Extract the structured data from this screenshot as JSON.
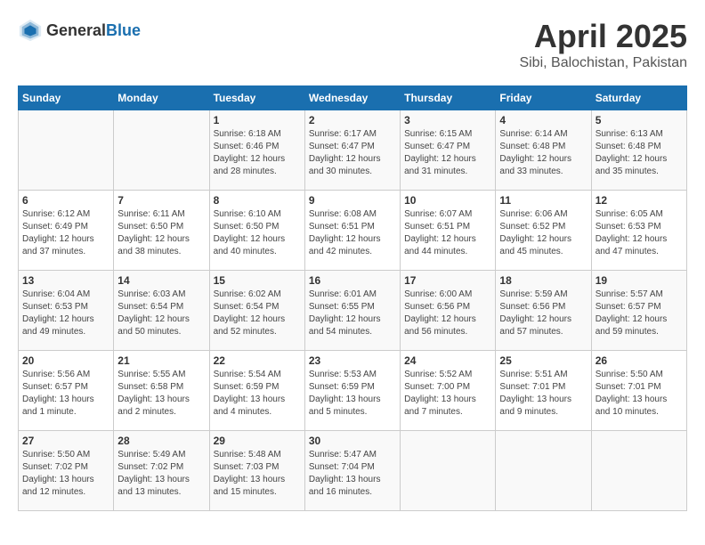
{
  "header": {
    "logo_general": "General",
    "logo_blue": "Blue",
    "month_year": "April 2025",
    "location": "Sibi, Balochistan, Pakistan"
  },
  "weekdays": [
    "Sunday",
    "Monday",
    "Tuesday",
    "Wednesday",
    "Thursday",
    "Friday",
    "Saturday"
  ],
  "weeks": [
    [
      {
        "day": "",
        "info": ""
      },
      {
        "day": "",
        "info": ""
      },
      {
        "day": "1",
        "sunrise": "Sunrise: 6:18 AM",
        "sunset": "Sunset: 6:46 PM",
        "daylight": "Daylight: 12 hours and 28 minutes."
      },
      {
        "day": "2",
        "sunrise": "Sunrise: 6:17 AM",
        "sunset": "Sunset: 6:47 PM",
        "daylight": "Daylight: 12 hours and 30 minutes."
      },
      {
        "day": "3",
        "sunrise": "Sunrise: 6:15 AM",
        "sunset": "Sunset: 6:47 PM",
        "daylight": "Daylight: 12 hours and 31 minutes."
      },
      {
        "day": "4",
        "sunrise": "Sunrise: 6:14 AM",
        "sunset": "Sunset: 6:48 PM",
        "daylight": "Daylight: 12 hours and 33 minutes."
      },
      {
        "day": "5",
        "sunrise": "Sunrise: 6:13 AM",
        "sunset": "Sunset: 6:48 PM",
        "daylight": "Daylight: 12 hours and 35 minutes."
      }
    ],
    [
      {
        "day": "6",
        "sunrise": "Sunrise: 6:12 AM",
        "sunset": "Sunset: 6:49 PM",
        "daylight": "Daylight: 12 hours and 37 minutes."
      },
      {
        "day": "7",
        "sunrise": "Sunrise: 6:11 AM",
        "sunset": "Sunset: 6:50 PM",
        "daylight": "Daylight: 12 hours and 38 minutes."
      },
      {
        "day": "8",
        "sunrise": "Sunrise: 6:10 AM",
        "sunset": "Sunset: 6:50 PM",
        "daylight": "Daylight: 12 hours and 40 minutes."
      },
      {
        "day": "9",
        "sunrise": "Sunrise: 6:08 AM",
        "sunset": "Sunset: 6:51 PM",
        "daylight": "Daylight: 12 hours and 42 minutes."
      },
      {
        "day": "10",
        "sunrise": "Sunrise: 6:07 AM",
        "sunset": "Sunset: 6:51 PM",
        "daylight": "Daylight: 12 hours and 44 minutes."
      },
      {
        "day": "11",
        "sunrise": "Sunrise: 6:06 AM",
        "sunset": "Sunset: 6:52 PM",
        "daylight": "Daylight: 12 hours and 45 minutes."
      },
      {
        "day": "12",
        "sunrise": "Sunrise: 6:05 AM",
        "sunset": "Sunset: 6:53 PM",
        "daylight": "Daylight: 12 hours and 47 minutes."
      }
    ],
    [
      {
        "day": "13",
        "sunrise": "Sunrise: 6:04 AM",
        "sunset": "Sunset: 6:53 PM",
        "daylight": "Daylight: 12 hours and 49 minutes."
      },
      {
        "day": "14",
        "sunrise": "Sunrise: 6:03 AM",
        "sunset": "Sunset: 6:54 PM",
        "daylight": "Daylight: 12 hours and 50 minutes."
      },
      {
        "day": "15",
        "sunrise": "Sunrise: 6:02 AM",
        "sunset": "Sunset: 6:54 PM",
        "daylight": "Daylight: 12 hours and 52 minutes."
      },
      {
        "day": "16",
        "sunrise": "Sunrise: 6:01 AM",
        "sunset": "Sunset: 6:55 PM",
        "daylight": "Daylight: 12 hours and 54 minutes."
      },
      {
        "day": "17",
        "sunrise": "Sunrise: 6:00 AM",
        "sunset": "Sunset: 6:56 PM",
        "daylight": "Daylight: 12 hours and 56 minutes."
      },
      {
        "day": "18",
        "sunrise": "Sunrise: 5:59 AM",
        "sunset": "Sunset: 6:56 PM",
        "daylight": "Daylight: 12 hours and 57 minutes."
      },
      {
        "day": "19",
        "sunrise": "Sunrise: 5:57 AM",
        "sunset": "Sunset: 6:57 PM",
        "daylight": "Daylight: 12 hours and 59 minutes."
      }
    ],
    [
      {
        "day": "20",
        "sunrise": "Sunrise: 5:56 AM",
        "sunset": "Sunset: 6:57 PM",
        "daylight": "Daylight: 13 hours and 1 minute."
      },
      {
        "day": "21",
        "sunrise": "Sunrise: 5:55 AM",
        "sunset": "Sunset: 6:58 PM",
        "daylight": "Daylight: 13 hours and 2 minutes."
      },
      {
        "day": "22",
        "sunrise": "Sunrise: 5:54 AM",
        "sunset": "Sunset: 6:59 PM",
        "daylight": "Daylight: 13 hours and 4 minutes."
      },
      {
        "day": "23",
        "sunrise": "Sunrise: 5:53 AM",
        "sunset": "Sunset: 6:59 PM",
        "daylight": "Daylight: 13 hours and 5 minutes."
      },
      {
        "day": "24",
        "sunrise": "Sunrise: 5:52 AM",
        "sunset": "Sunset: 7:00 PM",
        "daylight": "Daylight: 13 hours and 7 minutes."
      },
      {
        "day": "25",
        "sunrise": "Sunrise: 5:51 AM",
        "sunset": "Sunset: 7:01 PM",
        "daylight": "Daylight: 13 hours and 9 minutes."
      },
      {
        "day": "26",
        "sunrise": "Sunrise: 5:50 AM",
        "sunset": "Sunset: 7:01 PM",
        "daylight": "Daylight: 13 hours and 10 minutes."
      }
    ],
    [
      {
        "day": "27",
        "sunrise": "Sunrise: 5:50 AM",
        "sunset": "Sunset: 7:02 PM",
        "daylight": "Daylight: 13 hours and 12 minutes."
      },
      {
        "day": "28",
        "sunrise": "Sunrise: 5:49 AM",
        "sunset": "Sunset: 7:02 PM",
        "daylight": "Daylight: 13 hours and 13 minutes."
      },
      {
        "day": "29",
        "sunrise": "Sunrise: 5:48 AM",
        "sunset": "Sunset: 7:03 PM",
        "daylight": "Daylight: 13 hours and 15 minutes."
      },
      {
        "day": "30",
        "sunrise": "Sunrise: 5:47 AM",
        "sunset": "Sunset: 7:04 PM",
        "daylight": "Daylight: 13 hours and 16 minutes."
      },
      {
        "day": "",
        "info": ""
      },
      {
        "day": "",
        "info": ""
      },
      {
        "day": "",
        "info": ""
      }
    ]
  ]
}
